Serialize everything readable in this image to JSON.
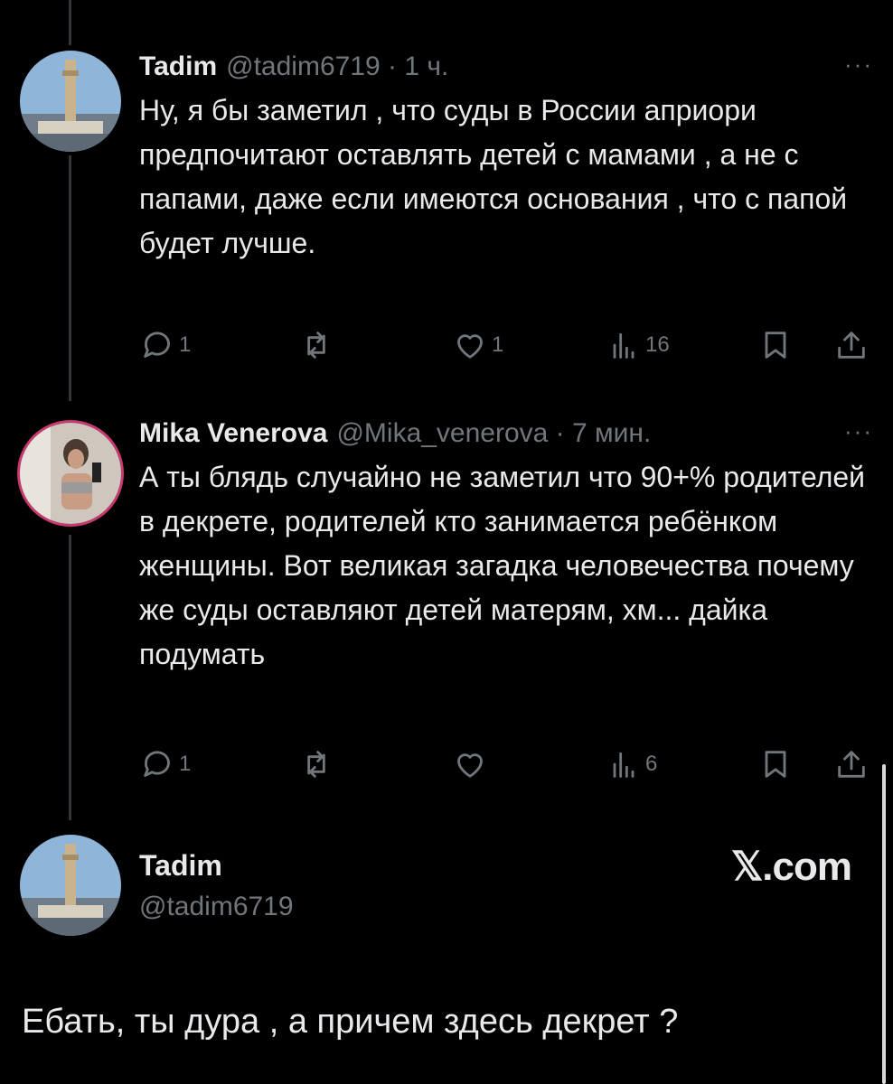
{
  "post1": {
    "name": "Tadim",
    "meta": "@tadim6719 · 1 ч.",
    "more": "···",
    "text": "Ну, я бы заметил , что суды в России априори предпочитают оставлять детей с мамами , а не с папами, даже если имеются основания , что с папой будет лучше.",
    "replies": "1",
    "likes": "1",
    "views": "16"
  },
  "post2": {
    "name": "Mika Venerova",
    "meta": "@Mika_venerova · 7 мин.",
    "more": "···",
    "text": "А ты блядь случайно не заметил что 90+% родителей в декрете, родителей кто занимается ребёнком женщины. Вот великая загадка человечества почему же суды оставляют детей матерям, хм... дайка подумать",
    "replies": "1",
    "likes": "",
    "views": "6"
  },
  "quote": {
    "name": "Tadim",
    "handle": "@tadim6719",
    "brand": "𝕏.com",
    "reply": "Ебать, ты дура , а причем здесь декрет ?"
  },
  "colors": {
    "background": "#000000",
    "text": "#e7e9ea",
    "muted": "#71767b",
    "story_ring": "#c63a6f"
  },
  "icons": [
    "reply-icon",
    "repost-icon",
    "like-icon",
    "views-icon",
    "bookmark-icon",
    "share-icon"
  ]
}
